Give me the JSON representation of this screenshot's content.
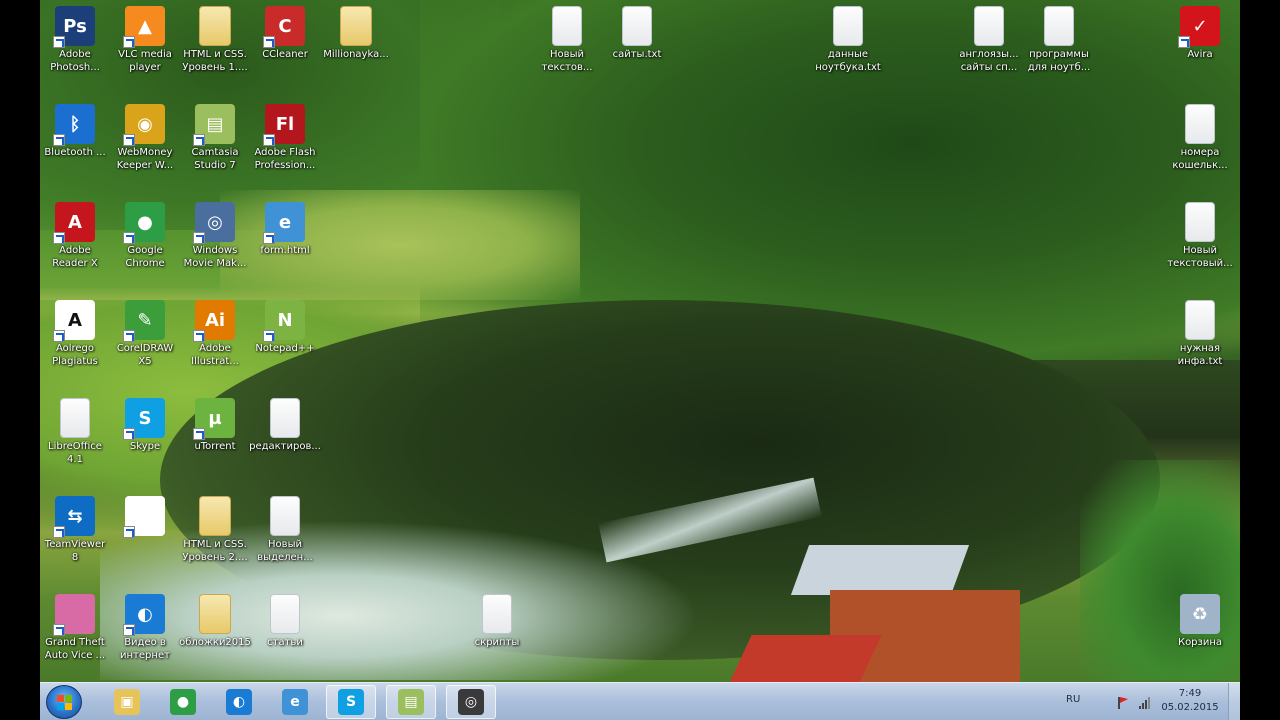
{
  "desktop": {
    "icons": [
      {
        "label": "Adobe\nPhotosh...",
        "glyph": "Ps",
        "color": "#1c3f7a",
        "icon": "photoshop-icon"
      },
      {
        "label": "Bluetooth ...",
        "glyph": "ᛒ",
        "color": "#1a6fd1",
        "icon": "bluetooth-icon"
      },
      {
        "label": "Adobe\nReader X",
        "glyph": "A",
        "color": "#c4161c",
        "icon": "adobe-reader-icon"
      },
      {
        "label": "Aolrego\nPlagiatus",
        "glyph": "A",
        "color": "#ffffff",
        "icon": "plagiatus-icon"
      },
      {
        "label": "LibreOffice\n4.1",
        "glyph": "",
        "color": "doc",
        "icon": "libreoffice-icon"
      },
      {
        "label": "TeamViewer\n8",
        "glyph": "⇆",
        "color": "#0e6cc4",
        "icon": "teamviewer-icon"
      },
      {
        "label": "Grand Theft\nAuto Vice ...",
        "glyph": "",
        "color": "#d86aa6",
        "icon": "gta-vice-city-icon"
      },
      {
        "label": "VLC media\nplayer",
        "glyph": "▲",
        "color": "#f58a1f",
        "icon": "vlc-icon"
      },
      {
        "label": "WebMoney\nKeeper W...",
        "glyph": "◉",
        "color": "#d9a41a",
        "icon": "webmoney-icon"
      },
      {
        "label": "Google\nChrome",
        "glyph": "●",
        "color": "#2e9e46",
        "icon": "chrome-icon"
      },
      {
        "label": "CorelDRAW\nX5",
        "glyph": "✎",
        "color": "#3b9e3b",
        "icon": "coreldraw-icon"
      },
      {
        "label": "Skype",
        "glyph": "S",
        "color": "#0fa0e3",
        "icon": "skype-icon"
      },
      {
        "label": "",
        "glyph": "",
        "color": "#ffffff",
        "icon": "teamviewer-blank-icon"
      },
      {
        "label": "Видео в\nинтернет",
        "glyph": "◐",
        "color": "#1a7bd4",
        "icon": "video-internet-icon"
      },
      {
        "label": "HTML и CSS.\nУровень 1....",
        "glyph": "",
        "color": "folder",
        "icon": "folder-icon"
      },
      {
        "label": "Camtasia\nStudio 7",
        "glyph": "▤",
        "color": "#9bbf5e",
        "icon": "camtasia-icon"
      },
      {
        "label": "Windows\nMovie Mak...",
        "glyph": "◎",
        "color": "#4a6f9e",
        "icon": "movie-maker-icon"
      },
      {
        "label": "Adobe\nIllustrat...",
        "glyph": "Ai",
        "color": "#e37a00",
        "icon": "illustrator-icon"
      },
      {
        "label": "uTorrent",
        "glyph": "µ",
        "color": "#6cb33f",
        "icon": "utorrent-icon"
      },
      {
        "label": "HTML и CSS.\nУровень 2....",
        "glyph": "",
        "color": "folder",
        "icon": "folder-icon"
      },
      {
        "label": "обложки2015",
        "glyph": "",
        "color": "folder",
        "icon": "folder-icon"
      },
      {
        "label": "CCleaner",
        "glyph": "C",
        "color": "#c92b2b",
        "icon": "ccleaner-icon"
      },
      {
        "label": "Adobe Flash\nProfession...",
        "glyph": "Fl",
        "color": "#b3161c",
        "icon": "flash-icon"
      },
      {
        "label": "form.html",
        "glyph": "e",
        "color": "#3f92d6",
        "icon": "html-file-icon"
      },
      {
        "label": "Notepad++",
        "glyph": "N",
        "color": "#7cb342",
        "icon": "notepad-plus-icon"
      },
      {
        "label": "редактиров...",
        "glyph": "",
        "color": "doc",
        "icon": "text-file-icon"
      },
      {
        "label": "Новый\nвыделен...",
        "glyph": "",
        "color": "doc",
        "icon": "text-file-icon"
      },
      {
        "label": "статьи",
        "glyph": "",
        "color": "doc",
        "icon": "text-file-icon"
      },
      {
        "label": "Millionayka...",
        "glyph": "",
        "color": "folder",
        "icon": "folder-icon"
      },
      {
        "label": "Новый\nтекстов...",
        "glyph": "",
        "color": "doc",
        "icon": "text-file-icon"
      },
      {
        "label": "сайты.txt",
        "glyph": "",
        "color": "doc",
        "icon": "text-file-icon"
      },
      {
        "label": "данные\nноутбука.txt",
        "glyph": "",
        "color": "doc",
        "icon": "text-file-icon"
      },
      {
        "label": "англоязы...\nсайты сп...",
        "glyph": "",
        "color": "doc",
        "icon": "text-file-icon"
      },
      {
        "label": "программы\nдля ноутб...",
        "glyph": "",
        "color": "doc",
        "icon": "text-file-icon"
      },
      {
        "label": "скрипты",
        "glyph": "",
        "color": "doc",
        "icon": "text-file-icon"
      },
      {
        "label": "Avira",
        "glyph": "✓",
        "color": "#d4141b",
        "icon": "avira-icon"
      },
      {
        "label": "номера\nкошельк...",
        "glyph": "",
        "color": "doc",
        "icon": "text-file-icon"
      },
      {
        "label": "Новый\nтекстовый...",
        "glyph": "",
        "color": "doc",
        "icon": "text-file-icon"
      },
      {
        "label": "нужная\nинфа.txt",
        "glyph": "",
        "color": "doc",
        "icon": "text-file-icon"
      },
      {
        "label": "Корзина",
        "glyph": "♻",
        "color": "#9fb3c9",
        "icon": "recycle-bin-icon"
      }
    ]
  },
  "taskbar": {
    "items": [
      {
        "glyph": "▣",
        "color": "#e6c45a",
        "icon": "explorer-icon"
      },
      {
        "glyph": "●",
        "color": "#2e9e46",
        "icon": "chrome-icon"
      },
      {
        "glyph": "◐",
        "color": "#1a7bd4",
        "icon": "video-internet-icon"
      },
      {
        "glyph": "e",
        "color": "#3f92d6",
        "icon": "internet-explorer-icon"
      },
      {
        "glyph": "S",
        "color": "#0fa0e3",
        "icon": "skype-icon"
      },
      {
        "glyph": "▤",
        "color": "#9bbf5e",
        "icon": "camtasia-icon"
      },
      {
        "glyph": "◎",
        "color": "#3a3a3a",
        "icon": "recorder-icon"
      }
    ],
    "tray": {
      "language": "RU",
      "time": "7:49",
      "date": "05.02.2015"
    }
  }
}
